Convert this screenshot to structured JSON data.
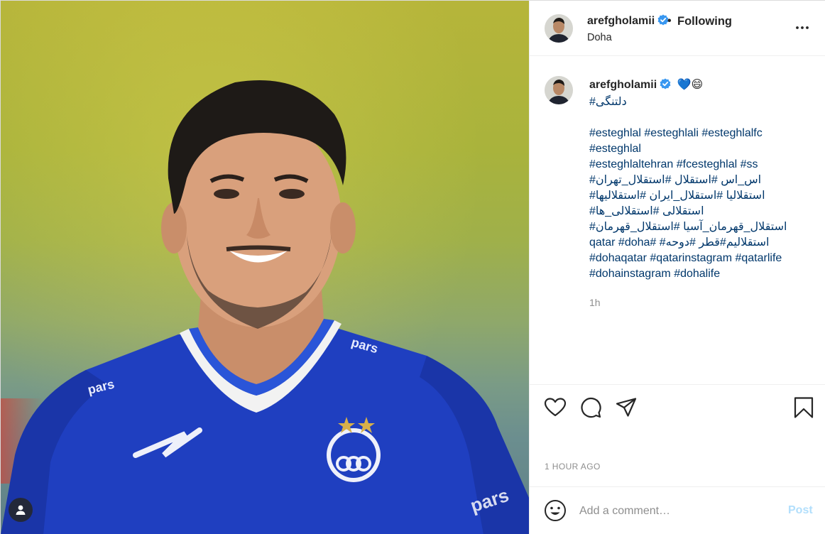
{
  "post_author": {
    "username": "arefgholamii",
    "verified": true,
    "follow_status": "Following",
    "location": "Doha"
  },
  "caption": {
    "username": "arefgholamii",
    "emoji": "💙😄",
    "line1": "#دلتنگی",
    "hashtags": [
      "#esteghlal #esteghlali #esteghlalfc",
      "#esteghlal",
      "#esteghlaltehran #fcesteghlal #ss",
      "اس_اس #استقلال #استقلال_تهران#",
      "استقلالیا #استقلال_ایران #استقلالیها#",
      "استقلالی #استقلالی_ها#",
      "استقلال_قهرمان_آسیا #استقلال_قهرمان#",
      "استقلالیم#قطر #دوحه# #qatar #doha",
      "#dohaqatar #qatarinstagram #qatarlife",
      "#dohainstagram #dohalife"
    ],
    "relative_time": "1h"
  },
  "photo": {
    "description_icon": "user-tag-icon"
  },
  "actions": {
    "icons": [
      "heart-icon",
      "comment-icon",
      "share-icon",
      "bookmark-icon"
    ]
  },
  "timestamp": "1 HOUR AGO",
  "comment_box": {
    "placeholder": "Add a comment…",
    "post_label": "Post"
  },
  "colors": {
    "verified": "#3897f0",
    "hashtag": "#00376b",
    "post_disabled": "#b2dffc",
    "muted": "#8e8e8e"
  }
}
